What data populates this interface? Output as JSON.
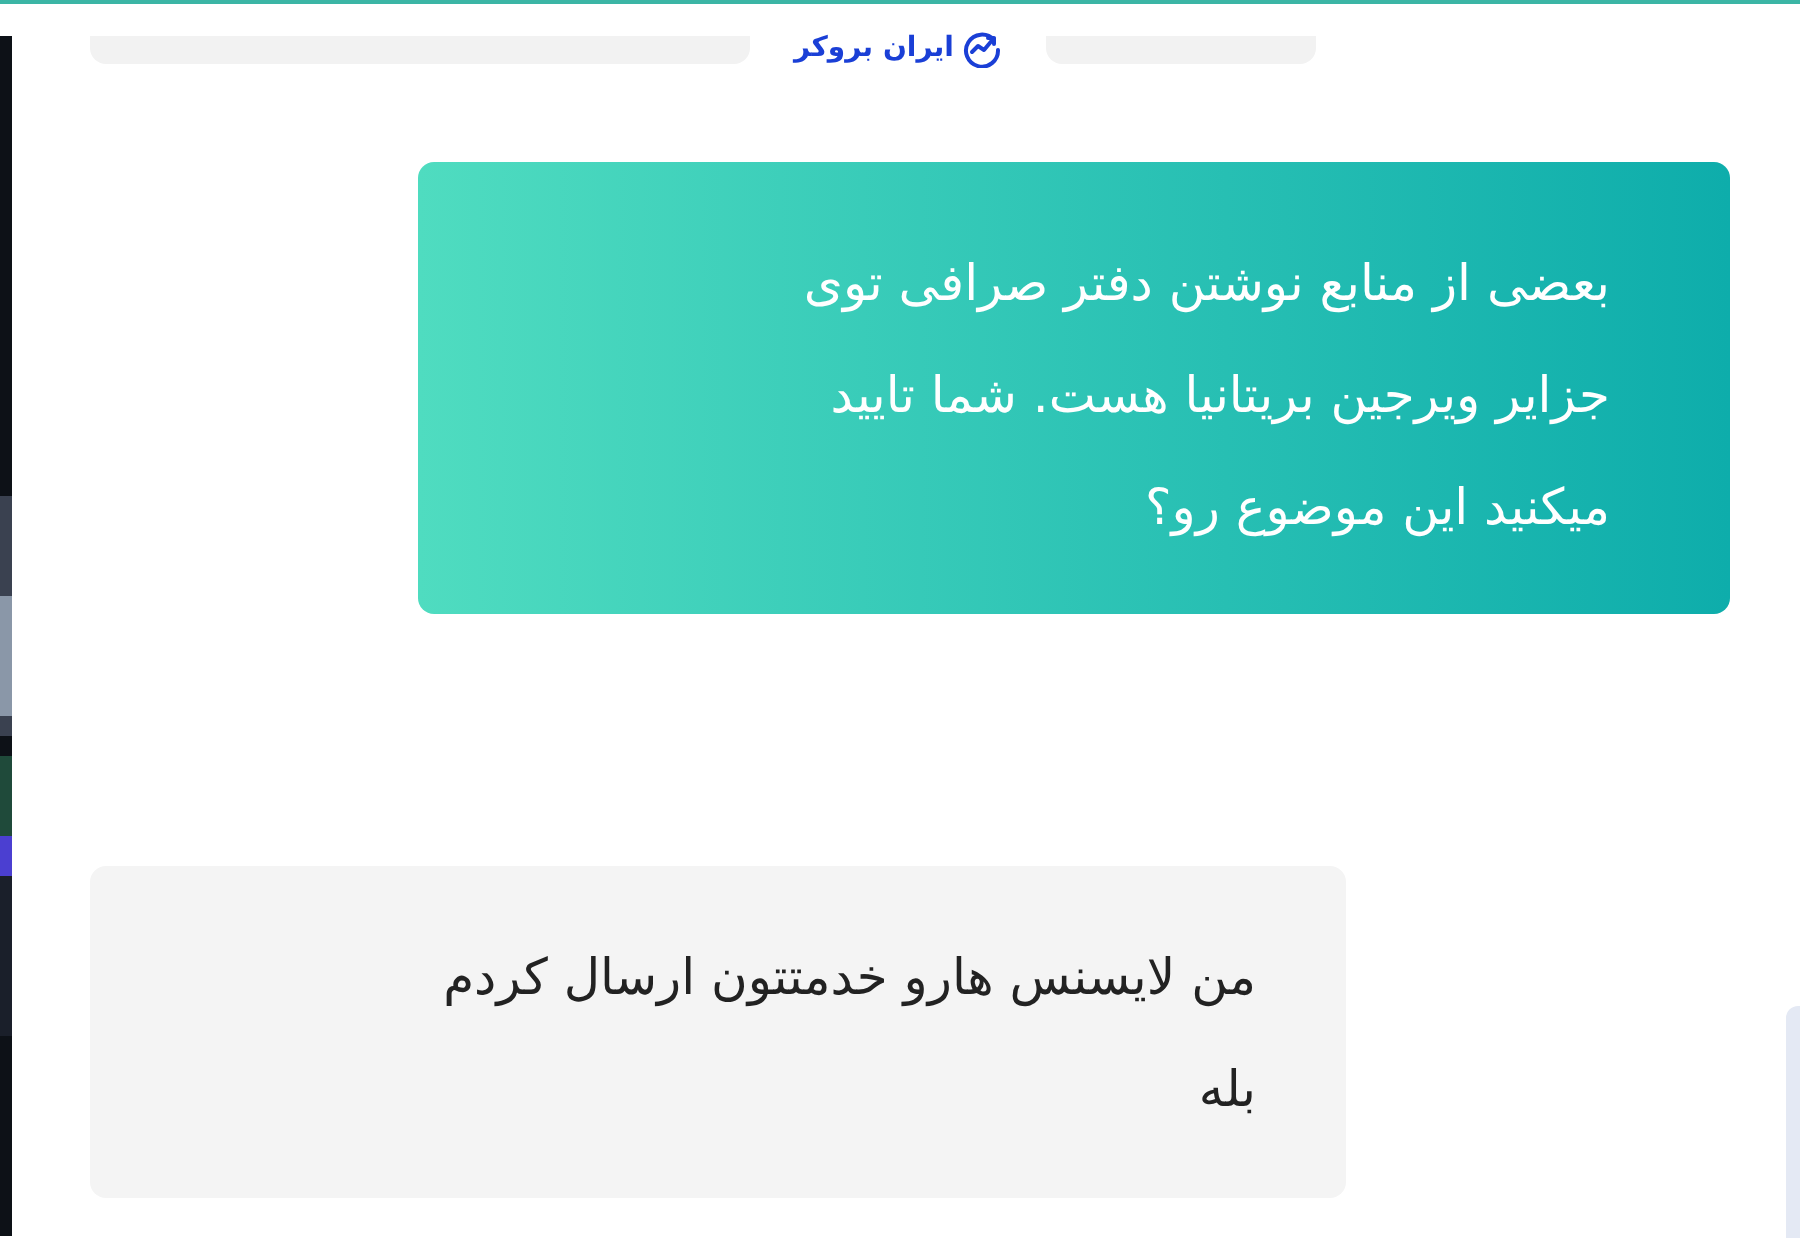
{
  "header": {
    "logo_text": "ایران بروکر"
  },
  "messages": [
    {
      "kind": "outgoing",
      "lines": [
        "بعضی از منابع نوشتن دفتر صرافی توی",
        "جزایر ویرجین بریتانیا هست. شما تایید",
        "میکنید این موضوع رو؟"
      ]
    },
    {
      "kind": "incoming",
      "lines": [
        "من لایسنس هارو خدمتتون ارسال کردم",
        "بله"
      ]
    }
  ]
}
